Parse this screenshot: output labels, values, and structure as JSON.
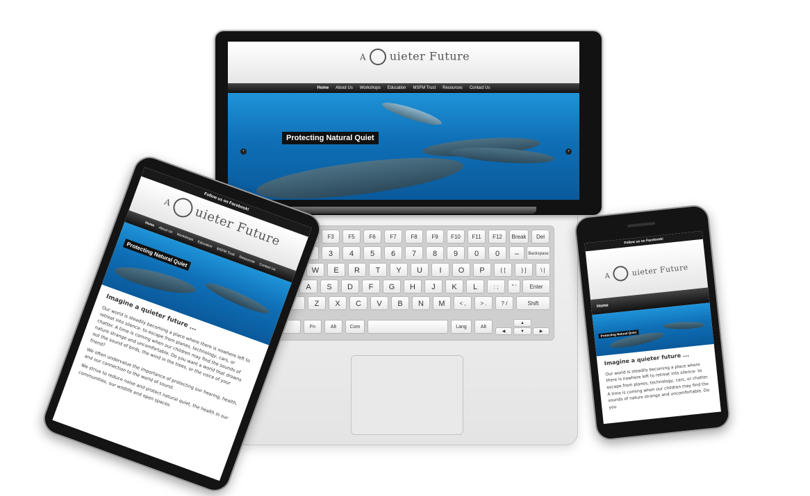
{
  "site": {
    "logo_a": "A",
    "logo_title": "uieter Future",
    "nav": [
      "Home",
      "About Us",
      "Workshops",
      "Education",
      "MSFM Trust",
      "Resources",
      "Contact Us"
    ],
    "slide_caption": "Protecting Natural Quiet",
    "fb_text": "Follow us on Facebook!",
    "mobile_menu": "Home",
    "heading": "Imagine a quieter future ...",
    "paragraph1": "Our world is steadily becoming a place where there is nowhere left to retreat into silence- to escape from planes, technology, cars, or chatter. A time is coming when our children may find the sounds of nature strange and uncomfortable. Do you want a world that drowns out the sound of birds, the wind in the trees, or the voice of your friend?",
    "paragraph2": "We often undervalue the importance of protecting our hearing, health, and our connection to the world of sound.",
    "paragraph3": "We strive to reduce noise and protect natural quiet, the health in our communities, our wildlife and open spaces.",
    "phone_paragraph": "Our world is steadily becoming a place where there is nowhere left to retreat into silence- to escape from planes, technology, cars, or chatter. A time is coming when our children may find the sounds of nature strange and uncomfortable. Do you",
    "arrow_left": "‹",
    "arrow_right": "›"
  },
  "keyboard": {
    "row0": [
      "F2",
      "F3",
      "F5",
      "F6",
      "F7",
      "F8",
      "F9",
      "F10",
      "F11",
      "F12",
      "Break",
      "Del"
    ],
    "row1": [
      "2",
      "3",
      "4",
      "5",
      "6",
      "7",
      "8",
      "9",
      "0",
      "0",
      "–",
      "Backspase"
    ],
    "row2": [
      "W",
      "E",
      "R",
      "T",
      "Y",
      "U",
      "I",
      "O",
      "P",
      "{ [",
      "} ]",
      "\\ |"
    ],
    "row3": [
      "A",
      "S",
      "D",
      "F",
      "G",
      "H",
      "J",
      "K",
      "L",
      ": ;",
      "\" '",
      "Enter"
    ],
    "row4": [
      "Z",
      "X",
      "C",
      "V",
      "B",
      "N",
      "M",
      "< ,",
      "> .",
      "? /",
      "Shift"
    ],
    "row5": [
      "Fn",
      "Alt",
      "Com",
      "Lang",
      "Alt"
    ],
    "arrow_up": "▲",
    "arrow_left": "◀",
    "arrow_down": "▼",
    "arrow_right": "▶"
  }
}
